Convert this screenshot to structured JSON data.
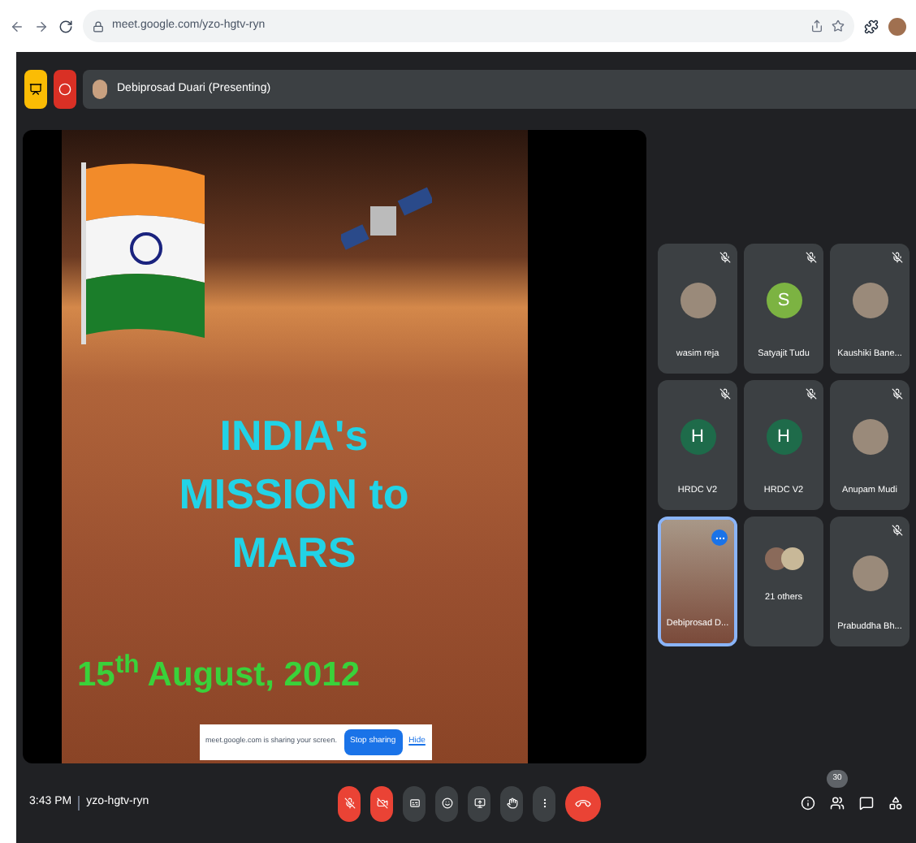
{
  "browser": {
    "url": "meet.google.com/yzo-hgtv-ryn"
  },
  "header": {
    "presenter": "Debiprosad Duari (Presenting)"
  },
  "slide": {
    "title": "INDIA's MISSION to MARS",
    "date": "15$^{th}$ August, 2012"
  },
  "share_banner": {
    "message": "meet.google.com is sharing your screen.",
    "stop_button": "Stop sharing",
    "hide_link": "Hide"
  },
  "tiles": [
    {
      "name": "wasim reja",
      "kind": "photo",
      "muted": true,
      "selected": false
    },
    {
      "name": "Satyajit Tudu",
      "kind": "letter",
      "letter": "S",
      "color": "#7cb342",
      "muted": true,
      "selected": false
    },
    {
      "name": "Kaushiki Bane...",
      "kind": "photo",
      "muted": true,
      "selected": false
    },
    {
      "name": "HRDC V2",
      "kind": "letter",
      "letter": "H",
      "color": "#1e6b4a",
      "muted": true,
      "selected": false
    },
    {
      "name": "HRDC V2",
      "kind": "letter",
      "letter": "H",
      "color": "#1e6b4a",
      "muted": true,
      "selected": false
    },
    {
      "name": "Anupam Mudi",
      "kind": "photo",
      "muted": true,
      "selected": false
    },
    {
      "name": "Debiprosad D...",
      "kind": "video",
      "muted": false,
      "selected": true
    },
    {
      "name": "21 others",
      "kind": "group",
      "muted": false,
      "selected": false
    },
    {
      "name": "Prabuddha Bh...",
      "kind": "photo",
      "muted": true,
      "selected": false
    }
  ],
  "bottom_bar": {
    "time": "3:43 PM",
    "meeting_code": "yzo-hgtv-ryn",
    "mic_on": false,
    "camera_on": false,
    "participant_count": "30"
  }
}
